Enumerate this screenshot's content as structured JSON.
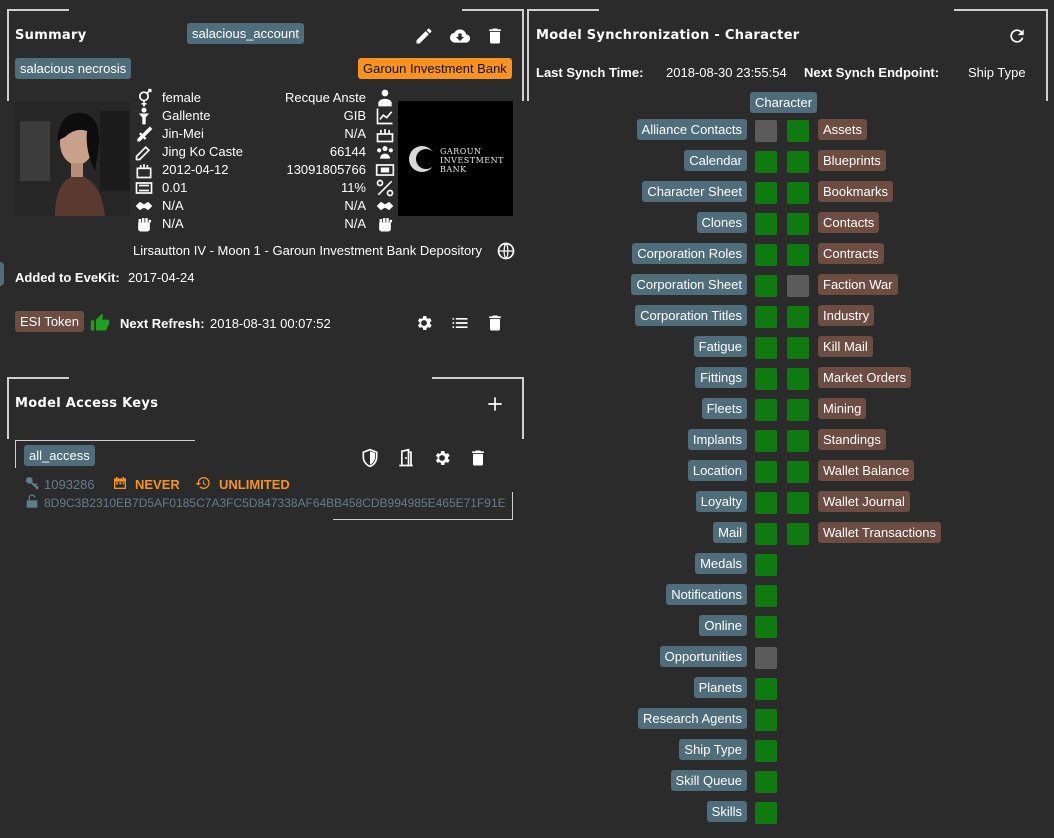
{
  "summary": {
    "title": "Summary",
    "account_tag": "salacious_account",
    "character_tag": "salacious necrosis",
    "corp_tag": "Garoun Investment Bank",
    "left_info": [
      "female",
      "Gallente",
      "Jin-Mei",
      "Jing Ko Caste",
      "2012-04-12",
      "0.01",
      "N/A",
      "N/A"
    ],
    "right_info": [
      "Recque Anste",
      "GIB",
      "N/A",
      "66144",
      "13091805766",
      "11%",
      "N/A",
      "N/A"
    ],
    "location": "Lirsautton IV - Moon 1 - Garoun Investment Bank Depository",
    "added_label": "Added to EveKit:",
    "added_value": "2017-04-24",
    "esi_tag": "ESI Token",
    "next_refresh_label": "Next Refresh:",
    "next_refresh_value": "2018-08-31 00:07:52",
    "corp_logo_text": [
      "GAROUN",
      "INVESTMENT",
      "BANK"
    ]
  },
  "access_keys": {
    "title": "Model Access Keys",
    "key_tag": "all_access",
    "key_id": "1093286",
    "expiry": "NEVER",
    "limit": "UNLIMITED",
    "hash": "8D9C3B2310EB7D5AF0185C7A3FC5D847338AF64BB458CDB994985E465E71F91E"
  },
  "sync": {
    "title": "Model Synchronization - Character",
    "last_label": "Last Synch Time:",
    "last_value": "2018-08-30 23:55:54",
    "next_label": "Next Synch Endpoint:",
    "next_value": "Ship Type",
    "column_header": "Character",
    "left_items": [
      {
        "label": "Alliance Contacts",
        "status": "gray"
      },
      {
        "label": "Calendar",
        "status": "green"
      },
      {
        "label": "Character Sheet",
        "status": "green"
      },
      {
        "label": "Clones",
        "status": "green"
      },
      {
        "label": "Corporation Roles",
        "status": "green"
      },
      {
        "label": "Corporation Sheet",
        "status": "green"
      },
      {
        "label": "Corporation Titles",
        "status": "green"
      },
      {
        "label": "Fatigue",
        "status": "green"
      },
      {
        "label": "Fittings",
        "status": "green"
      },
      {
        "label": "Fleets",
        "status": "green"
      },
      {
        "label": "Implants",
        "status": "green"
      },
      {
        "label": "Location",
        "status": "green"
      },
      {
        "label": "Loyalty",
        "status": "green"
      },
      {
        "label": "Mail",
        "status": "green"
      },
      {
        "label": "Medals",
        "status": "green"
      },
      {
        "label": "Notifications",
        "status": "green"
      },
      {
        "label": "Online",
        "status": "green"
      },
      {
        "label": "Opportunities",
        "status": "gray"
      },
      {
        "label": "Planets",
        "status": "green"
      },
      {
        "label": "Research Agents",
        "status": "green"
      },
      {
        "label": "Ship Type",
        "status": "green"
      },
      {
        "label": "Skill Queue",
        "status": "green"
      },
      {
        "label": "Skills",
        "status": "green"
      }
    ],
    "right_items": [
      {
        "label": "Assets",
        "status": "green"
      },
      {
        "label": "Blueprints",
        "status": "green"
      },
      {
        "label": "Bookmarks",
        "status": "green"
      },
      {
        "label": "Contacts",
        "status": "green"
      },
      {
        "label": "Contracts",
        "status": "green"
      },
      {
        "label": "Faction War",
        "status": "gray"
      },
      {
        "label": "Industry",
        "status": "green"
      },
      {
        "label": "Kill Mail",
        "status": "green"
      },
      {
        "label": "Market Orders",
        "status": "green"
      },
      {
        "label": "Mining",
        "status": "green"
      },
      {
        "label": "Standings",
        "status": "green"
      },
      {
        "label": "Wallet Balance",
        "status": "green"
      },
      {
        "label": "Wallet Journal",
        "status": "green"
      },
      {
        "label": "Wallet Transactions",
        "status": "green"
      }
    ]
  },
  "colors": {
    "background": "#2b2b2b",
    "blue_tag": "#4f6d7a",
    "brown_tag": "#6d4c41",
    "orange_tag": "#f7931e",
    "status_green": "#0f7a0f",
    "status_gray": "#5b5b5b",
    "warning_orange": "#f7931e",
    "link_blue": "#5d7f8c"
  }
}
